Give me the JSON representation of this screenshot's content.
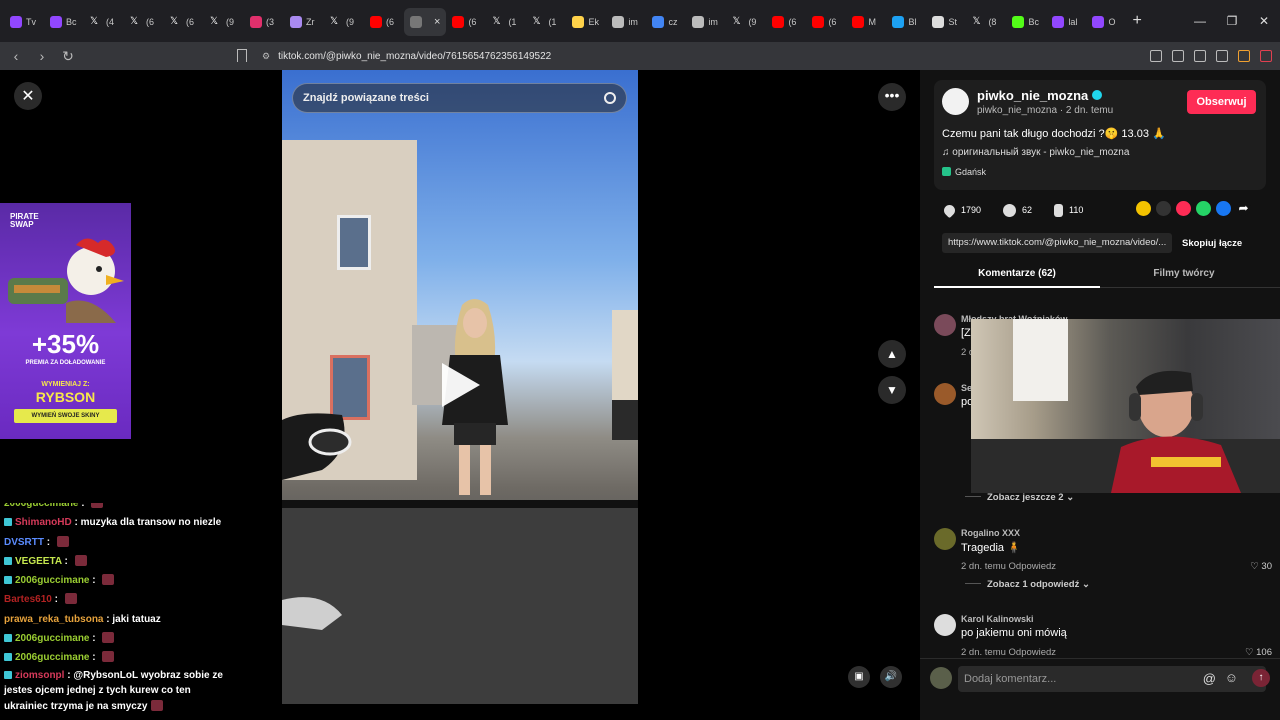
{
  "browser": {
    "tabs": [
      {
        "label": "Tv",
        "color": "#9147ff"
      },
      {
        "label": "Bc",
        "color": "#9147ff"
      },
      {
        "label": "(4",
        "color": "#ffffff",
        "icon": "x"
      },
      {
        "label": "(6",
        "color": "#ffffff",
        "icon": "x"
      },
      {
        "label": "(6",
        "color": "#ffffff",
        "icon": "x"
      },
      {
        "label": "(9",
        "color": "#ffffff",
        "icon": "x"
      },
      {
        "label": "(3",
        "color": "#e1306c"
      },
      {
        "label": "Zr",
        "color": "#a98af0"
      },
      {
        "label": "(9",
        "color": "#ffffff",
        "icon": "x"
      },
      {
        "label": "(6",
        "color": "#ff0000"
      },
      {
        "label": "",
        "color": "#777777",
        "active": true
      },
      {
        "label": "(6",
        "color": "#ff0000"
      },
      {
        "label": "(1",
        "color": "#ffffff",
        "icon": "x"
      },
      {
        "label": "(1",
        "color": "#ffffff",
        "icon": "x"
      },
      {
        "label": "Ek",
        "color": "#ffd24a"
      },
      {
        "label": "im",
        "color": "#bbbbbb"
      },
      {
        "label": "cz",
        "color": "#4285f4"
      },
      {
        "label": "im",
        "color": "#bbbbbb"
      },
      {
        "label": "(9",
        "color": "#ffffff",
        "icon": "x"
      },
      {
        "label": "(6",
        "color": "#ff0000"
      },
      {
        "label": "(6",
        "color": "#ff0000"
      },
      {
        "label": "M",
        "color": "#ff0000"
      },
      {
        "label": "Bl",
        "color": "#1da1f2"
      },
      {
        "label": "St",
        "color": "#dddddd"
      },
      {
        "label": "(8",
        "color": "#ffffff",
        "icon": "x"
      },
      {
        "label": "Bc",
        "color": "#53fc18"
      },
      {
        "label": "lal",
        "color": "#9147ff"
      },
      {
        "label": "O",
        "color": "#9147ff"
      }
    ],
    "close_tab": "×",
    "new_tab": "+",
    "url": "tiktok.com/@piwko_nie_mozna/video/7615654762356149522"
  },
  "ad": {
    "brand_line1": "PIRATE",
    "brand_line2": "SWAP",
    "percent": "+35%",
    "sub1": "PREMIA ZA DOŁADOWANIE",
    "sub2": "WYMIENIAJ Z:",
    "name": "RYBSON",
    "cta": "WYMIEŃ SWOJE SKINY"
  },
  "chat": [
    {
      "user": "2006guccimane",
      "color": "#9acd32",
      "text": "",
      "emote": true,
      "partial": true
    },
    {
      "user": "ShimanoHD",
      "color": "#d63a5a",
      "text": "muzyka dla transow no niezle",
      "badge": true
    },
    {
      "user": "DVSRTT",
      "color": "#5b8cff",
      "text": "",
      "emote": true
    },
    {
      "user": "VEGEETA",
      "color": "#c6e84f",
      "text": "",
      "emote": true,
      "badge": true
    },
    {
      "user": "2006guccimane",
      "color": "#9acd32",
      "text": "",
      "emote": true,
      "badge": true
    },
    {
      "user": "Bartes610",
      "color": "#b22222",
      "text": "",
      "emote": true
    },
    {
      "user": "prawa_reka_tubsona",
      "color": "#e6a23c",
      "text": "jaki tatuaz"
    },
    {
      "user": "2006guccimane",
      "color": "#9acd32",
      "text": "",
      "emote": true,
      "badge": true
    },
    {
      "user": "2006guccimane",
      "color": "#9acd32",
      "text": "",
      "emote": true,
      "badge": true
    },
    {
      "user": "ziomsonpl",
      "color": "#d63a5a",
      "text": "@RybsonLoL wyobraz sobie ze jestes ojcem jednej z tych kurew co ten ukrainiec trzyma je na smyczy",
      "badge": true,
      "wrap": true,
      "emote": true
    }
  ],
  "video": {
    "search_placeholder": "Znajdź powiązane treści"
  },
  "post": {
    "username": "piwko_nie_mozna",
    "meta": "piwko_nie_mozna · 2 dn. temu",
    "follow": "Obserwuj",
    "caption": "Czemu pani tak długo dochodzi ?🤫 13.03 🙏",
    "sound": "♫  оригинальный звук - piwko_nie_mozna",
    "location": "Gdańsk",
    "likes": "1790",
    "comments_count": "62",
    "saves": "110",
    "link": "https://www.tiktok.com/@piwko_nie_mozna/video/...",
    "copy": "Skopiuj łącze"
  },
  "tabs": {
    "comments": "Komentarze (62)",
    "creator_videos": "Filmy twórcy"
  },
  "comments": [
    {
      "name": "Młodszy brat Woźniaków",
      "text": "[Z",
      "meta": "2 d",
      "like": "",
      "color": "#7a4a5a"
    },
    {
      "name": "Se",
      "text": "po",
      "meta": "",
      "like": "",
      "color": "#9a5a2a"
    },
    {
      "name": "Rogalino XXX",
      "text": "Tragedia 🧍",
      "meta": "2 dn. temu    Odpowiedz",
      "like": "♡ 30",
      "color": "#6a6a2a"
    },
    {
      "name": "Karol Kalinowski",
      "text": "po jakiemu oni mówią",
      "meta": "2 dn. temu    Odpowiedz",
      "like": "♡ 106",
      "color": "#dddddd"
    }
  ],
  "see_more_1": "Zobacz jeszcze 2 ⌄",
  "see_more_2": "Zobacz 1 odpowiedź ⌄",
  "comment_input_placeholder": "Dodaj komentarz..."
}
